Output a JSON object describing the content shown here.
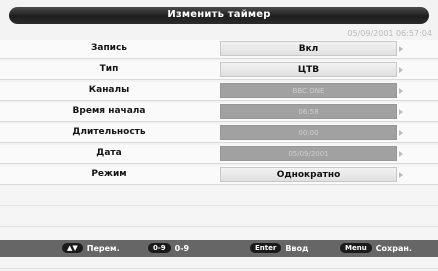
{
  "header": {
    "title": "Изменить таймер",
    "datetime": "05/09/2001 06:57:04"
  },
  "rows": [
    {
      "label": "Запись",
      "value": "Вкл",
      "state": "active"
    },
    {
      "label": "Тип",
      "value": "ЦТВ",
      "state": "active"
    },
    {
      "label": "Каналы",
      "value": "BBC ONE",
      "state": "disabled"
    },
    {
      "label": "Время начала",
      "value": "06:58",
      "state": "disabled"
    },
    {
      "label": "Длительность",
      "value": "00:00",
      "state": "disabled"
    },
    {
      "label": "Дата",
      "value": "05/09/2001",
      "state": "disabled"
    },
    {
      "label": "Режим",
      "value": "Однократно",
      "state": "active"
    }
  ],
  "footer": {
    "move_key": "▲▼",
    "move_label": "Перем.",
    "digits_key": "0-9",
    "digits_label": "0-9",
    "enter_key": "Enter",
    "enter_label": "Ввод",
    "menu_key": "Menu",
    "menu_label": "Сохран."
  }
}
